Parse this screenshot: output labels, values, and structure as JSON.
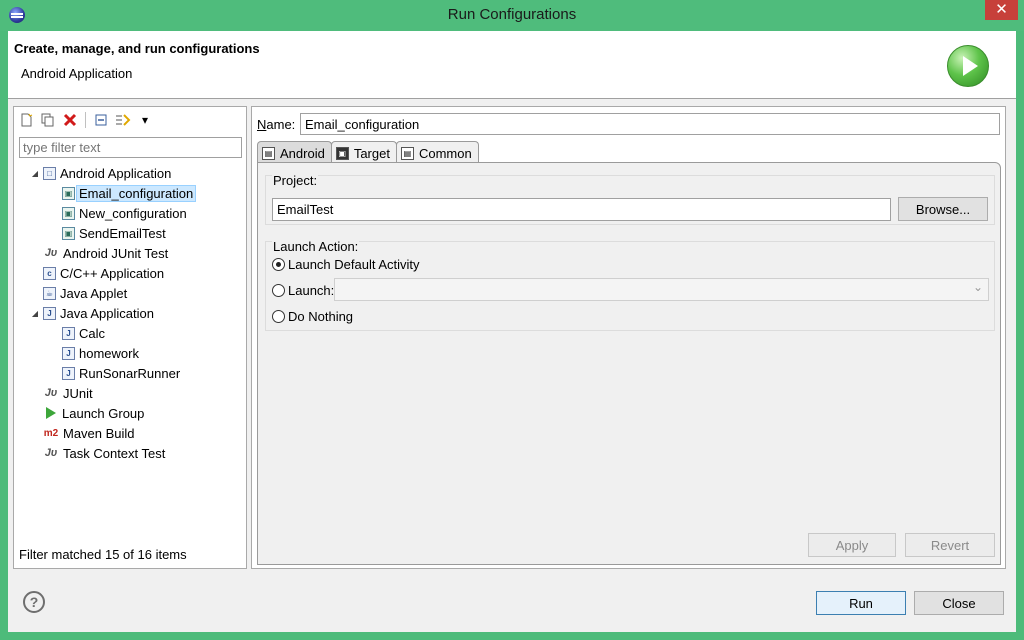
{
  "window": {
    "title": "Run Configurations",
    "close_label": "✕"
  },
  "header": {
    "title": "Create, manage, and run configurations",
    "subtitle": "Android Application"
  },
  "left": {
    "filter_placeholder": "type filter text",
    "tree": [
      {
        "label": "Android Application",
        "level": 0,
        "expanded": true,
        "icon": "android-app-icon"
      },
      {
        "label": "Email_configuration",
        "level": 1,
        "selected": true,
        "icon": "config-icon"
      },
      {
        "label": "New_configuration",
        "level": 1,
        "icon": "config-icon"
      },
      {
        "label": "SendEmailTest",
        "level": 1,
        "icon": "config-icon"
      },
      {
        "label": "Android JUnit Test",
        "level": 0,
        "icon": "junit-icon"
      },
      {
        "label": "C/C++ Application",
        "level": 0,
        "icon": "cpp-icon"
      },
      {
        "label": "Java Applet",
        "level": 0,
        "icon": "applet-icon"
      },
      {
        "label": "Java Application",
        "level": 0,
        "expanded": true,
        "icon": "java-app-icon"
      },
      {
        "label": "Calc",
        "level": 1,
        "icon": "java-config-icon"
      },
      {
        "label": "homework",
        "level": 1,
        "icon": "java-config-icon"
      },
      {
        "label": "RunSonarRunner",
        "level": 1,
        "icon": "java-config-icon"
      },
      {
        "label": "JUnit",
        "level": 0,
        "icon": "junit-icon"
      },
      {
        "label": "Launch Group",
        "level": 0,
        "icon": "launch-group-icon"
      },
      {
        "label": "Maven Build",
        "level": 0,
        "icon": "maven-icon"
      },
      {
        "label": "Task Context Test",
        "level": 0,
        "icon": "task-context-icon"
      }
    ],
    "status": "Filter matched 15 of 16 items"
  },
  "right": {
    "name_label": "Name:",
    "name_value": "Email_configuration",
    "tabs": [
      "Android",
      "Target",
      "Common"
    ],
    "project_label": "Project:",
    "project_value": "EmailTest",
    "browse_label": "Browse...",
    "launch_action_label": "Launch Action:",
    "options": [
      "Launch Default Activity",
      "Launch:",
      "Do Nothing"
    ],
    "selected_option": "Launch Default Activity",
    "apply_label": "Apply",
    "revert_label": "Revert"
  },
  "footer": {
    "run_label": "Run",
    "close_label": "Close"
  }
}
